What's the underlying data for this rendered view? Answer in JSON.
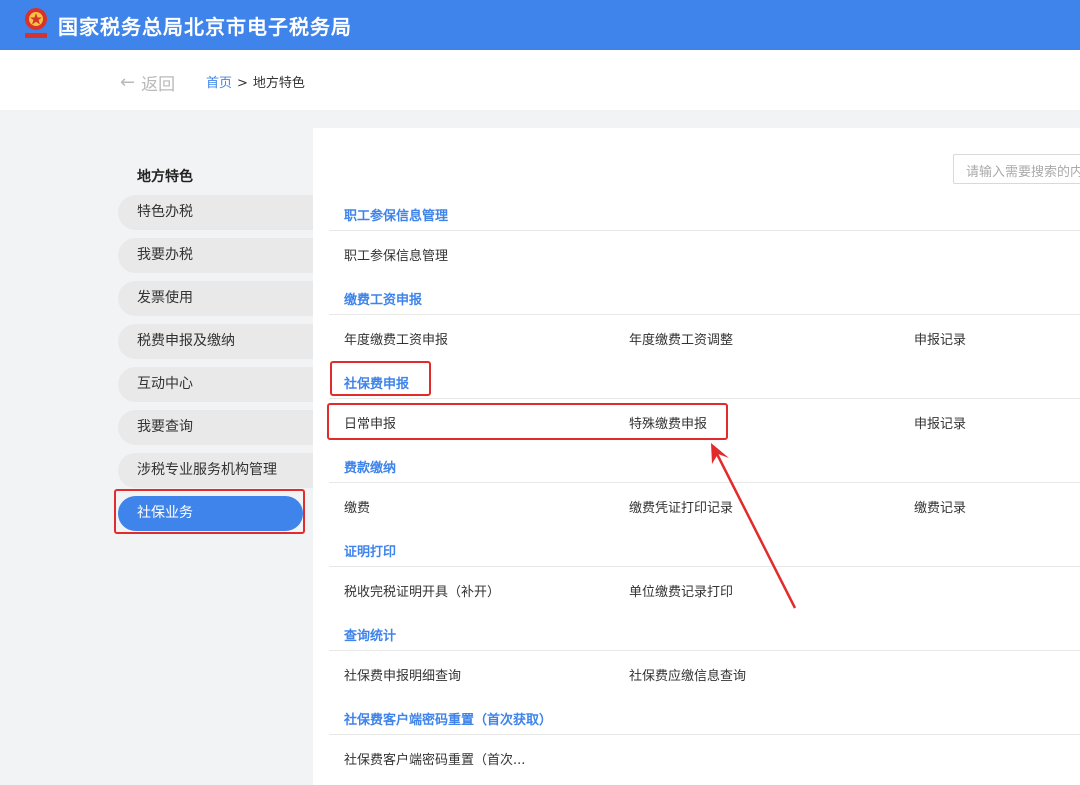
{
  "header": {
    "title": "国家税务总局北京市电子税务局",
    "emblem_icon": "tax-emblem-icon"
  },
  "nav": {
    "back_label": "返回",
    "back_icon": "arrow-left-icon",
    "breadcrumb_home": "首页",
    "breadcrumb_sep": ">",
    "breadcrumb_current": "地方特色"
  },
  "sidebar": {
    "title": "地方特色",
    "items": [
      {
        "label": "特色办税"
      },
      {
        "label": "我要办税"
      },
      {
        "label": "发票使用"
      },
      {
        "label": "税费申报及缴纳"
      },
      {
        "label": "互动中心"
      },
      {
        "label": "我要查询"
      },
      {
        "label": "涉税专业服务机构管理"
      },
      {
        "label": "社保业务",
        "active": true
      }
    ]
  },
  "search": {
    "placeholder": "请输入需要搜索的内容"
  },
  "sections": [
    {
      "title": "职工参保信息管理",
      "links": [
        "职工参保信息管理"
      ]
    },
    {
      "title": "缴费工资申报",
      "links": [
        "年度缴费工资申报",
        "年度缴费工资调整",
        "申报记录"
      ]
    },
    {
      "title": "社保费申报",
      "links": [
        "日常申报",
        "特殊缴费申报",
        "申报记录"
      ]
    },
    {
      "title": "费款缴纳",
      "links": [
        "缴费",
        "缴费凭证打印记录",
        "缴费记录"
      ]
    },
    {
      "title": "证明打印",
      "links": [
        "税收完税证明开具（补开）",
        "单位缴费记录打印"
      ]
    },
    {
      "title": "查询统计",
      "links": [
        "社保费申报明细查询",
        "社保费应缴信息查询"
      ]
    },
    {
      "title": "社保费客户端密码重置（首次获取）",
      "links": [
        "社保费客户端密码重置（首次..."
      ]
    }
  ],
  "colors": {
    "brand": "#3f84ea",
    "annotation": "#e22b2b"
  }
}
